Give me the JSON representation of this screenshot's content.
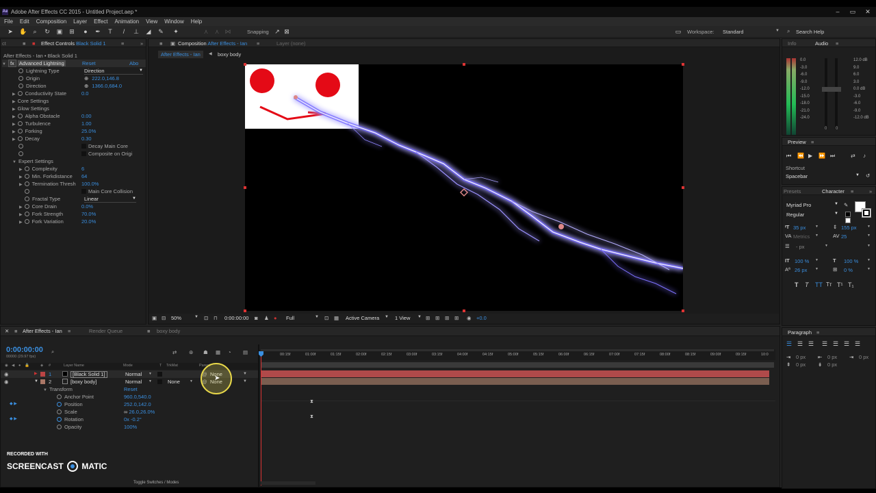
{
  "window": {
    "title": "Adobe After Effects CC 2015 - Untitled Project.aep *"
  },
  "menu": [
    "File",
    "Edit",
    "Composition",
    "Layer",
    "Effect",
    "Animation",
    "View",
    "Window",
    "Help"
  ],
  "toolbar": {
    "snapping": "Snapping",
    "workspace_label": "Workspace:",
    "workspace_value": "Standard",
    "search_help": "Search Help"
  },
  "effect_controls": {
    "tab": "Effect Controls",
    "layer": "Black Solid 1",
    "breadcrumb": "After Effects - Ian • Black Solid 1",
    "effect_name": "Advanced Lightning",
    "reset": "Reset",
    "about": "Abo",
    "props": [
      {
        "label": "Lightning Type",
        "value": "Direction"
      },
      {
        "label": "Origin",
        "value": "222.0,146.8"
      },
      {
        "label": "Direction",
        "value": "1366.0,684.0"
      },
      {
        "label": "Conductivity State",
        "value": "0.0"
      },
      {
        "label": "Core Settings",
        "value": ""
      },
      {
        "label": "Glow Settings",
        "value": ""
      },
      {
        "label": "Alpha Obstacle",
        "value": "0.00"
      },
      {
        "label": "Turbulence",
        "value": "1.00"
      },
      {
        "label": "Forking",
        "value": "25.0%"
      },
      {
        "label": "Decay",
        "value": "0.30"
      },
      {
        "label": "",
        "value": "Decay Main Core"
      },
      {
        "label": "",
        "value": "Composite on Origi"
      },
      {
        "label": "Expert Settings",
        "value": ""
      },
      {
        "label": "Complexity",
        "value": "6"
      },
      {
        "label": "Min. Forkdistance",
        "value": "64"
      },
      {
        "label": "Termination Thresh",
        "value": "100.0%"
      },
      {
        "label": "",
        "value": "Main Core Collision"
      },
      {
        "label": "Fractal Type",
        "value": "Linear"
      },
      {
        "label": "Core Drain",
        "value": "0.0%"
      },
      {
        "label": "Fork Strength",
        "value": "70.0%"
      },
      {
        "label": "Fork Variation",
        "value": "20.0%"
      }
    ]
  },
  "composition": {
    "tab_prefix": "Composition",
    "tab_name": "After Effects - Ian",
    "layer_tab": "Layer (none)",
    "crumb1": "After Effects - Ian",
    "crumb2": "boxy body",
    "zoom": "50%",
    "timecode": "0:00:00:00",
    "resolution": "Full",
    "camera": "Active Camera",
    "views": "1 View",
    "exposure": "+0.0"
  },
  "info": {
    "tab": "Info"
  },
  "audio": {
    "tab": "Audio",
    "left_scale": [
      "0.0",
      "-3.0",
      "-6.0",
      "-9.0",
      "-12.0",
      "-15.0",
      "-18.0",
      "-21.0",
      "-24.0"
    ],
    "right_scale": [
      "12.0 dB",
      "9.0",
      "6.0",
      "3.0",
      "0.0 dB",
      "-3.0",
      "-6.0",
      "-9.0",
      "-12.0 dB"
    ],
    "knob_left": "0",
    "knob_right": "0"
  },
  "preview": {
    "tab": "Preview",
    "shortcut_label": "Shortcut",
    "shortcut_value": "Spacebar"
  },
  "character": {
    "presets_tab": "Presets",
    "tab": "Character",
    "font": "Myriad Pro",
    "style": "Regular",
    "size": "35 px",
    "leading": "155 px",
    "kerning": "Metrics",
    "tracking": "25",
    "stroke": "- px",
    "vscale": "100 %",
    "hscale": "100 %",
    "baseline": "26 px",
    "tsume": "0 %"
  },
  "paragraph": {
    "tab": "Paragraph",
    "indent_left": "0 px",
    "indent_right": "0 px",
    "space_before": "0 px",
    "indent_first": "0 px",
    "space_after": "0 px"
  },
  "timeline": {
    "tabs": [
      "After Effects - Ian",
      "Render Queue",
      "boxy body"
    ],
    "timecode": "0:00:00:00",
    "fps": "00000 (29.97 fps)",
    "col_layer": "Layer Name",
    "col_mode": "Mode",
    "col_t": "T",
    "col_trkmat": "TrkMat",
    "col_parent": "Parent",
    "ruler": [
      "00:15f",
      "01:00f",
      "01:15f",
      "02:00f",
      "02:15f",
      "03:00f",
      "03:15f",
      "04:00f",
      "04:15f",
      "05:00f",
      "05:15f",
      "06:00f",
      "06:15f",
      "07:00f",
      "07:15f",
      "08:00f",
      "08:15f",
      "09:00f",
      "09:15f",
      "10:0"
    ],
    "layers": [
      {
        "num": "1",
        "name": "[Black Solid 1]",
        "mode": "Normal",
        "trkmat": "",
        "parent": "None"
      },
      {
        "num": "2",
        "name": "[boxy body]",
        "mode": "Normal",
        "trkmat": "None",
        "parent": "None"
      }
    ],
    "transform": "Transform",
    "transform_reset": "Reset",
    "transform_props": [
      {
        "label": "Anchor Point",
        "value": "960.0,540.0"
      },
      {
        "label": "Position",
        "value": "252.0,142.0"
      },
      {
        "label": "Scale",
        "value": "26.0,26.0%"
      },
      {
        "label": "Rotation",
        "value": "0x -0.2°"
      },
      {
        "label": "Opacity",
        "value": "100%"
      }
    ],
    "toggle": "Toggle Switches / Modes"
  },
  "watermark": {
    "line1": "RECORDED WITH",
    "line2a": "SCREENCAST",
    "line2b": "MATIC"
  },
  "colors": {
    "accent": "#3a8fe0",
    "layer1_bar": "#b04a4a",
    "layer2_bar": "#7a5e50",
    "cursor_ring": "#e8d84a",
    "lightning": "#5a4dff"
  }
}
